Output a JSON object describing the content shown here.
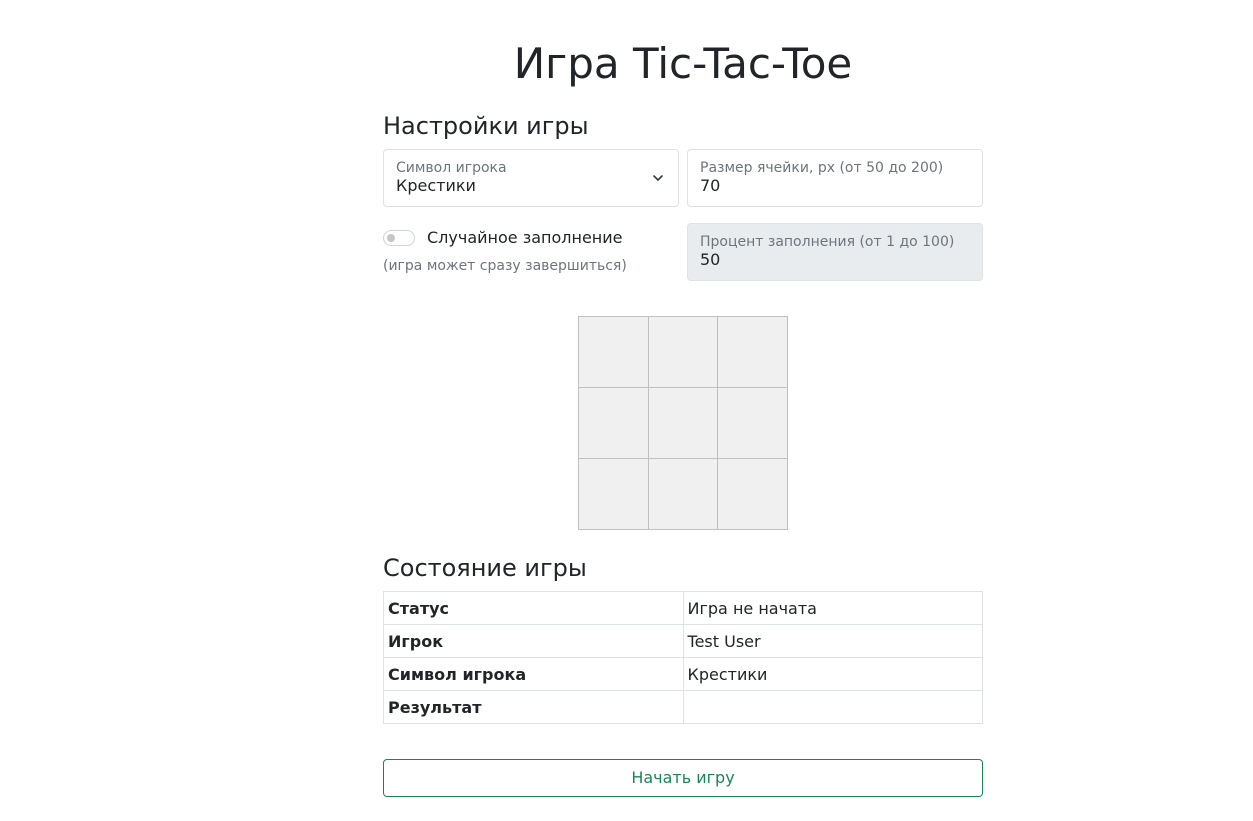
{
  "page_title": "Игра Tic-Tac-Toe",
  "settings": {
    "heading": "Настройки игры",
    "symbol": {
      "label": "Символ игрока",
      "value": "Крестики"
    },
    "cell_size": {
      "label": "Размер ячейки, px (от 50 до 200)",
      "value": "70"
    },
    "random_fill": {
      "label": "Случайное заполнение",
      "hint": "(игра может сразу завершиться)",
      "enabled": false
    },
    "fill_percent": {
      "label": "Процент заполнения (от 1 до 100)",
      "value": "50",
      "disabled": true
    }
  },
  "board": {
    "rows": 3,
    "cols": 3,
    "cells": [
      "",
      "",
      "",
      "",
      "",
      "",
      "",
      "",
      ""
    ]
  },
  "state": {
    "heading": "Состояние игры",
    "rows": [
      {
        "key": "Статус",
        "value": "Игра не начата"
      },
      {
        "key": "Игрок",
        "value": "Test User"
      },
      {
        "key": "Символ игрока",
        "value": "Крестики"
      },
      {
        "key": "Результат",
        "value": ""
      }
    ]
  },
  "actions": {
    "start_label": "Начать игру"
  },
  "colors": {
    "accent": "#198754",
    "cell_bg": "#f0f0f0",
    "disabled_bg": "#e9ecef"
  }
}
